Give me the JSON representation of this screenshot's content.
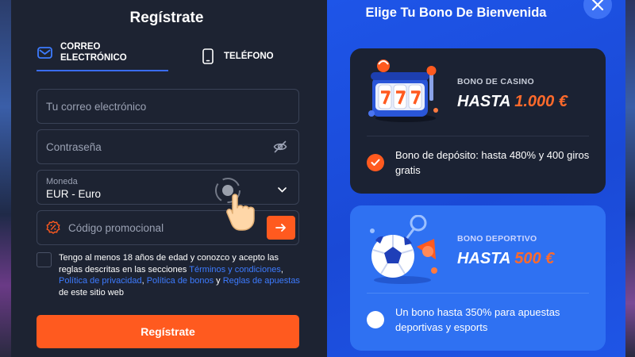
{
  "register": {
    "title": "Regístrate",
    "tabs": [
      {
        "line1": "CORREO",
        "line2": "ELECTRÓNICO"
      },
      {
        "line1": "TELÉFONO"
      }
    ],
    "email_placeholder": "Tu correo electrónico",
    "password_placeholder": "Contraseña",
    "currency_label": "Moneda",
    "currency_value": "EUR - Euro",
    "promo_placeholder": "Código promocional",
    "terms": {
      "t1": "Tengo al menos 18 años de edad y conozco y acepto las reglas descritas en las secciones ",
      "link1": "Términos y condiciones",
      "sep1": ", ",
      "link2": "Política de privacidad",
      "sep2": ", ",
      "link3": "Política de bonos",
      "sep3": " y ",
      "link4": "Reglas de apuestas",
      "t2": " de este sitio web"
    },
    "submit_label": "Regístrate"
  },
  "bonus": {
    "title": "Elige Tu Bono De Bienvenida",
    "cards": [
      {
        "kicker": "BONO DE CASINO",
        "headline_prefix": "HASTA ",
        "headline_amount": "1.000 €",
        "description": "Bono de depósito: hasta 480% y 400 giros gratis",
        "selected": true
      },
      {
        "kicker": "BONO DEPORTIVO",
        "headline_prefix": "HASTA ",
        "headline_amount": "500 €",
        "description": "Un bono hasta 350% para apuestas deportivas y esports",
        "selected": false
      }
    ]
  },
  "colors": {
    "accent": "#ff5a1f",
    "link": "#3d7bff",
    "panel": "#1d2332",
    "bonus_bg": "#1e55e8"
  },
  "icons": [
    "mail-icon",
    "phone-icon",
    "eye-off-icon",
    "chevron-down-icon",
    "percent-badge-icon",
    "arrow-right-icon",
    "close-icon",
    "check-icon",
    "hand-cursor-icon",
    "slot-machine-illustration",
    "soccer-ball-illustration"
  ]
}
